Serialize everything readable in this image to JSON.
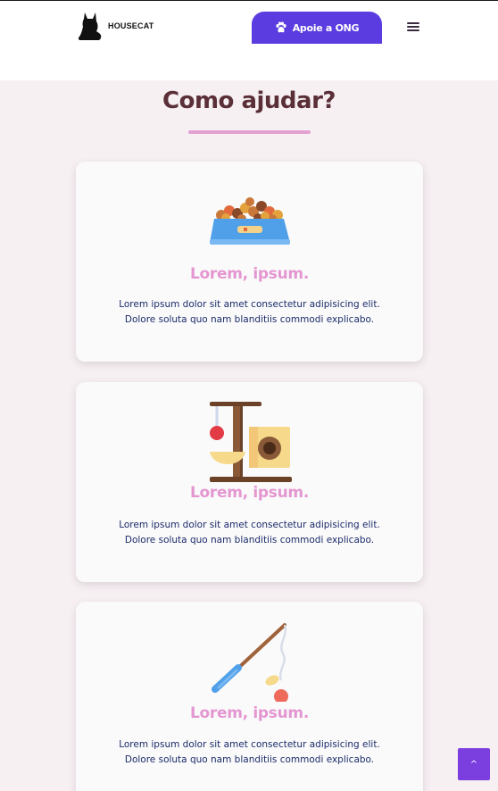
{
  "header": {
    "logo_text": "HOUSECAT",
    "cta_label": "Apoie a ONG",
    "menu_icon": "hamburger-icon"
  },
  "section": {
    "title": "Como ajudar?"
  },
  "cards": [
    {
      "icon": "food-bowl-icon",
      "heading": "Lorem, ipsum.",
      "text_line1": "Lorem ipsum dolor sit amet consectetur adipisicing elit.",
      "text_line2": "Dolore soluta quo nam blanditiis commodi explicabo."
    },
    {
      "icon": "cat-tree-icon",
      "heading": "Lorem, ipsum.",
      "text_line1": "Lorem ipsum dolor sit amet consectetur adipisicing elit.",
      "text_line2": "Dolore soluta quo nam blanditiis commodi explicabo."
    },
    {
      "icon": "cat-wand-toy-icon",
      "heading": "Lorem, ipsum.",
      "text_line1": "Lorem ipsum dolor sit amet consectetur adipisicing elit.",
      "text_line2": "Dolore soluta quo nam blanditiis commodi explicabo."
    }
  ],
  "scroll_top": {
    "label": "^",
    "icon": "chevron-up-icon"
  },
  "colors": {
    "cta": "#5b3ce0",
    "title": "#5a2f37",
    "accent": "#e3a1d2",
    "card_heading": "#e496d1",
    "body_text": "#1b2a6a",
    "scroll_top": "#7b3fe0"
  }
}
